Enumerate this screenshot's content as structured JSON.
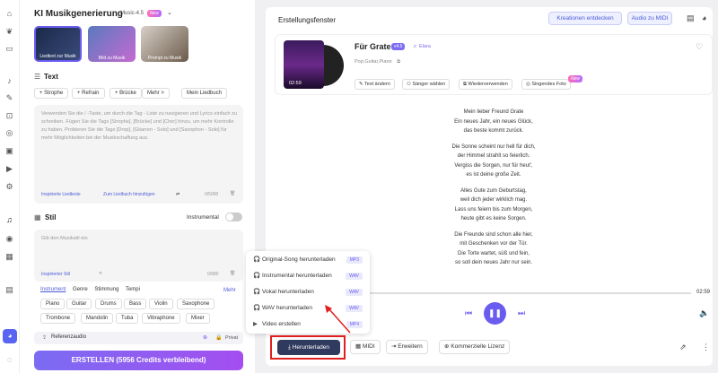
{
  "header": {
    "title": "KI Musikgenerierung",
    "model": "Music-4.5",
    "new_badge": "New"
  },
  "modes": [
    {
      "label": "Liedtext zur Musik"
    },
    {
      "label": "Bild zu Musik"
    },
    {
      "label": "Prompt zu Musik"
    }
  ],
  "text_section": {
    "title": "Text",
    "chips": [
      "+ Strophe",
      "+ Refrain",
      "+ Brücke",
      "Mehr >",
      "Mein Liedbuch"
    ],
    "placeholder": "Verwenden Sie die / -Taste, um durch die Tag - Liste zu navigieren und Lyrics einfach zu schreiben. Fügen Sie die Tags [Strophe], [Brücke] und [Chor] hinzu, um mehr Kontrolle zu haben. Probieren Sie die Tags [Drop], [Gitarren - Solo] und [Saxophon - Solo] für mehr Möglichkeiten bei der Musikschaffung aus.",
    "inspire": "Inspirierte Liedtexte",
    "add_songbook": "Zum Liedbuch hinzufügen",
    "count": "0/5000"
  },
  "style_section": {
    "title": "Stil",
    "instrumental": "Instrumental",
    "placeholder": "Gib den Musikstil ein",
    "inspire": "Inspirierter Stil",
    "count": "0/980",
    "tabs": [
      "Instrument",
      "Genre",
      "Stimmung",
      "Tempi"
    ],
    "more": "Mehr",
    "instruments": [
      "Piano",
      "Guitar",
      "Drums",
      "Bass",
      "Violin",
      "Saxophone",
      "Trombone",
      "Mandolin",
      "Tuba",
      "Vibraphone",
      "Mixer"
    ]
  },
  "bottom": {
    "ref_audio": "Referenzaudio",
    "private": "Privat"
  },
  "create_button": "ERSTELLEN (5956 Credits verbleibend)",
  "right": {
    "title": "Erstellungsfenster",
    "discover": "Kreationen entdecken",
    "audio_midi": "Audio zu MIDI"
  },
  "song": {
    "title": "Für Grate",
    "version": "v4.5",
    "artist": "Elara",
    "tags": "Pop,Guitar,Piano",
    "duration": "02:59",
    "actions": [
      "Text ändern",
      "Sänger wählen",
      "Wiederverwenden",
      "Singendes Foto"
    ],
    "new_badge": "New"
  },
  "lyrics": [
    "Mein lieber Freund Grate",
    "Ein neues Jahr, ein neues Glück,",
    "das beste kommt zurück.",
    "",
    "Die Sonne scheint nur hell für dich,",
    "der Himmel strahlt so feierlich.",
    "Vergiss die Sorgen, nur für heut',",
    "es ist deine große Zeit.",
    "",
    "Alles Gute zum Geburtstag,",
    "weil dich jeder wirklich mag.",
    "Lass uns feiern bis zum Morgen,",
    "heute gibt es keine Sorgen.",
    "",
    "Die Freunde sind schon alle hier,",
    "mit Geschenken vor der Tür.",
    "Die Torte wartet, süß und fein,",
    "so soll dein neues Jahr nur sein."
  ],
  "player": {
    "time": "02:59",
    "progress": 0.0
  },
  "download_menu": [
    {
      "label": "Original-Song herunterladen",
      "format": "MP3"
    },
    {
      "label": "Instrumental herunterladen",
      "format": "WAV"
    },
    {
      "label": "Vokal herunterladen",
      "format": "WAV"
    },
    {
      "label": "WAV herunterladen",
      "format": "WAV"
    },
    {
      "label": "Video erstellen",
      "format": "MP4"
    }
  ],
  "bottom_actions": {
    "download": "Herunterladen",
    "midi": "MIDI",
    "extend": "Erweitern",
    "license": "Kommerzielle Lizenz"
  }
}
